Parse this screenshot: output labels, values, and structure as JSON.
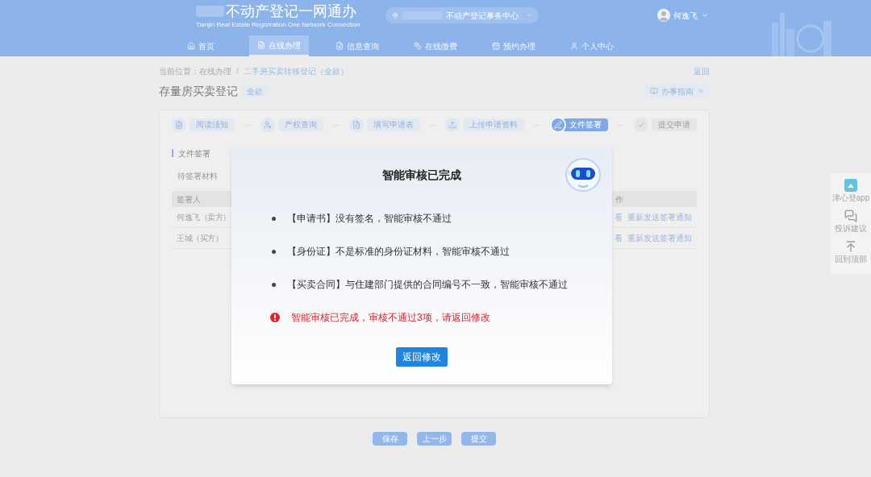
{
  "header": {
    "logo_title": "不动产登记一网通办",
    "logo_subtitle": "Tianjin Real Estate Registration One Network Connection",
    "location": "不动产登记事务中心",
    "user_name": "何逸飞"
  },
  "nav": [
    {
      "label": "首页",
      "selected": false
    },
    {
      "label": "在线办理",
      "selected": true
    },
    {
      "label": "信息查询",
      "selected": false
    },
    {
      "label": "在线缴费",
      "selected": false
    },
    {
      "label": "预约办理",
      "selected": false
    },
    {
      "label": "个人中心",
      "selected": false
    }
  ],
  "breadcrumb": {
    "prefix": "当前位置：",
    "items": [
      "在线办理",
      "二手房买卖转移登记（全款）"
    ],
    "separator": "/",
    "back_link": "返回"
  },
  "page": {
    "title": "存量房买卖登记",
    "tag": "全款",
    "guide_button": "办事指南"
  },
  "steps": [
    {
      "label": "阅读须知",
      "selected": false
    },
    {
      "label": "产权查询",
      "selected": false
    },
    {
      "label": "填写申请表",
      "selected": false
    },
    {
      "label": "上传申请资料",
      "selected": false
    },
    {
      "label": "文件签署",
      "selected": true
    },
    {
      "label": "提交申请",
      "selected": false
    }
  ],
  "section": {
    "title": "文件签署",
    "tabs": [
      {
        "label": "待签署材料",
        "selected": false
      }
    ]
  },
  "table": {
    "columns": [
      "签署人",
      "作"
    ],
    "rows": [
      {
        "signer": "何逸飞（卖方）",
        "action_1": "看",
        "action_2": "重新发送签署通知"
      },
      {
        "signer": "王城（买方）",
        "action_1": "看",
        "action_2": "重新发送签署通知"
      }
    ]
  },
  "footer_buttons": [
    "保存",
    "上一步",
    "提交"
  ],
  "side_toolbar": [
    "津心登app",
    "投诉建议",
    "回到顶部"
  ],
  "dialog": {
    "title": "智能审核已完成",
    "items": [
      "【申请书】没有签名，智能审核不通过",
      "【身份证】不是标准的身份证材料，智能审核不通过",
      "【买卖合同】与住建部门提供的合同编号不一致，智能审核不通过"
    ],
    "error": "智能审核已完成，审核不通过3项，请返回修改",
    "button": "返回修改"
  }
}
